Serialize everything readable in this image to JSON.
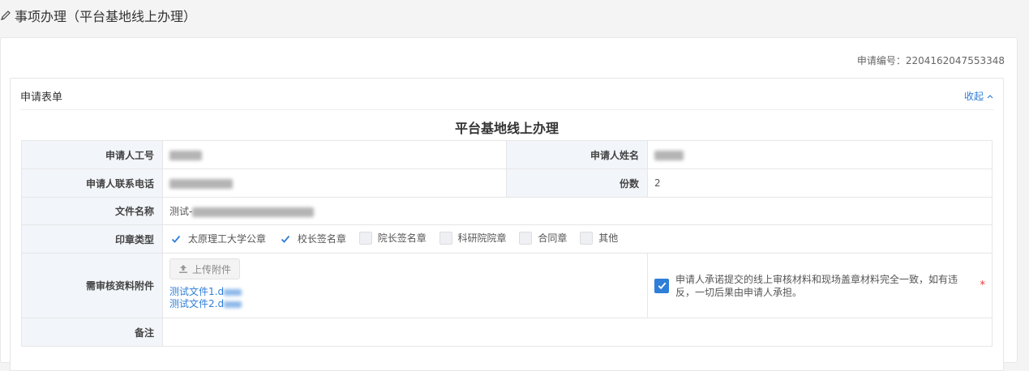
{
  "page": {
    "title": "事项办理（平台基地线上办理）"
  },
  "application": {
    "number_label": "申请编号：",
    "number": "2204162047553348"
  },
  "card": {
    "title": "申请表单",
    "collapse_label": "收起"
  },
  "form": {
    "title": "平台基地线上办理",
    "fields": {
      "employee_id_label": "申请人工号",
      "employee_name_label": "申请人姓名",
      "phone_label": "申请人联系电话",
      "copies_label": "份数",
      "copies_value": "2",
      "filename_label": "文件名称",
      "filename_prefix": "测试-",
      "seal_type_label": "印章类型",
      "attachments_label": "需审核资料附件",
      "remarks_label": "备注"
    },
    "seal_options": [
      {
        "label": "太原理工大学公章",
        "checked": true
      },
      {
        "label": "校长签名章",
        "checked": true
      },
      {
        "label": "院长签名章",
        "checked": false
      },
      {
        "label": "科研院院章",
        "checked": false
      },
      {
        "label": "合同章",
        "checked": false
      },
      {
        "label": "其他",
        "checked": false
      }
    ],
    "upload_label": "上传附件",
    "files": [
      {
        "name": "测试文件1.d"
      },
      {
        "name": "测试文件2.d"
      }
    ],
    "promise": {
      "checked": true,
      "text": "申请人承诺提交的线上审核材料和现场盖章材料完全一致，如有违反，一切后果由申请人承担。",
      "required_mark": "*"
    }
  },
  "colors": {
    "accent": "#2f7ed8",
    "label_bg": "#f2f5f9",
    "border": "#e6e6e6",
    "required": "#ee3333"
  }
}
